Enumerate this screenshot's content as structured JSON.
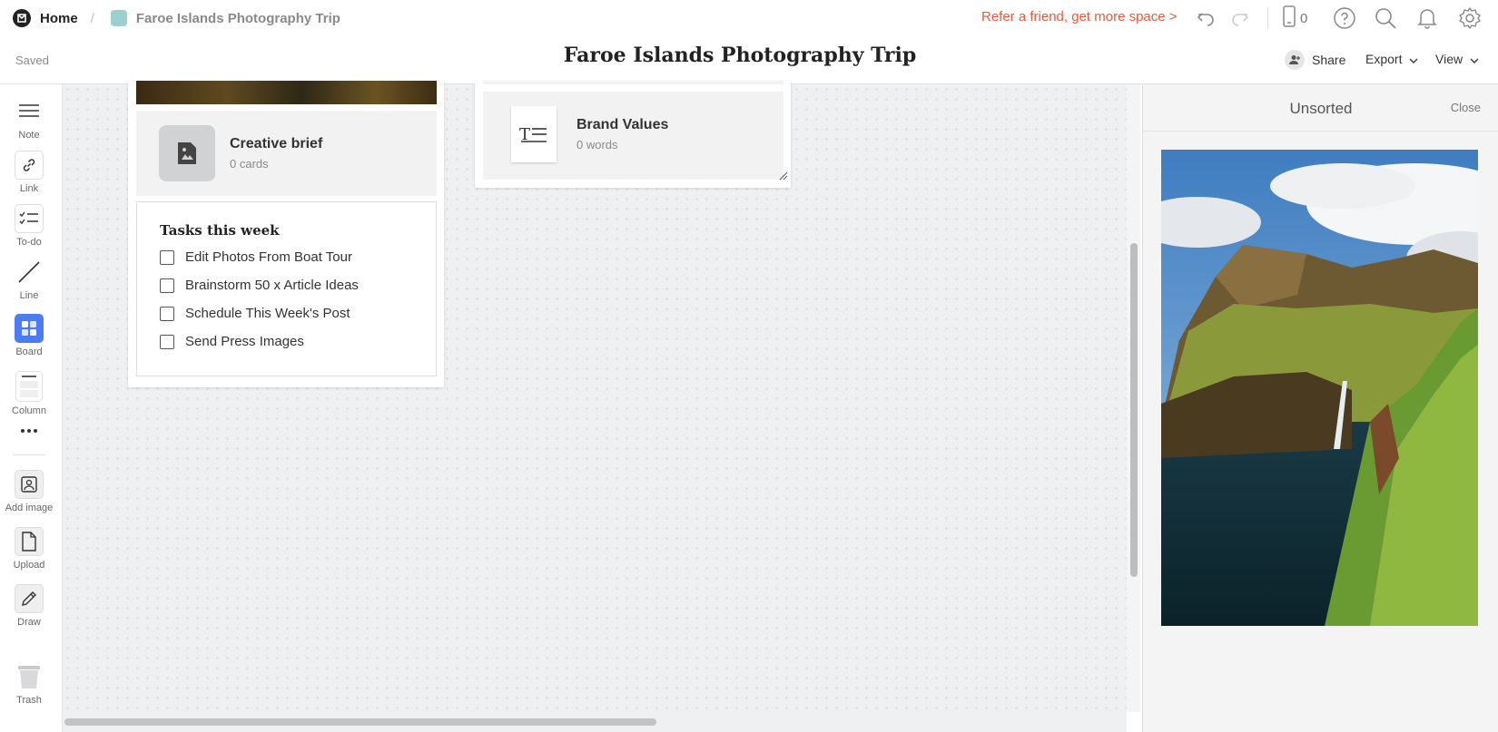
{
  "breadcrumb": {
    "home_label": "Home",
    "separator": "/",
    "board_label": "Faroe Islands Photography Trip",
    "board_color": "#9ccfd0"
  },
  "topbar": {
    "refer_text": "Refer a friend, get more space >",
    "device_count": "0",
    "icons": [
      "undo-icon",
      "redo-icon",
      "mobile-icon",
      "help-icon",
      "search-icon",
      "bell-icon",
      "gear-icon"
    ],
    "accent_color": "#e55a3a"
  },
  "header": {
    "saved_status": "Saved",
    "title": "Faroe Islands Photography Trip",
    "share_label": "Share",
    "export_label": "Export",
    "view_label": "View"
  },
  "toolbar": {
    "items": [
      {
        "label": "Note",
        "icon": "note-icon"
      },
      {
        "label": "Link",
        "icon": "link-icon"
      },
      {
        "label": "To-do",
        "icon": "todo-icon"
      },
      {
        "label": "Line",
        "icon": "line-icon"
      },
      {
        "label": "Board",
        "icon": "board-icon"
      },
      {
        "label": "Column",
        "icon": "column-icon"
      },
      {
        "label": "Add image",
        "icon": "add-image-icon"
      },
      {
        "label": "Upload",
        "icon": "upload-icon"
      },
      {
        "label": "Draw",
        "icon": "pencil-icon"
      },
      {
        "label": "Trash",
        "icon": "trash-icon"
      }
    ],
    "more_icon": "more-icon",
    "board_accent": "#4c7cf3"
  },
  "canvas": {
    "creative_brief": {
      "title": "Creative brief",
      "meta": "0 cards"
    },
    "brand_values": {
      "title": "Brand Values",
      "meta": "0 words"
    },
    "todo": {
      "title": "Tasks this week",
      "items": [
        {
          "label": "Edit Photos From Boat Tour",
          "checked": false
        },
        {
          "label": "Brainstorm 50 x Article Ideas",
          "checked": false
        },
        {
          "label": "Schedule This Week's Post",
          "checked": false
        },
        {
          "label": "Send Press Images",
          "checked": false
        }
      ]
    }
  },
  "unsorted": {
    "title": "Unsorted",
    "close_label": "Close"
  }
}
